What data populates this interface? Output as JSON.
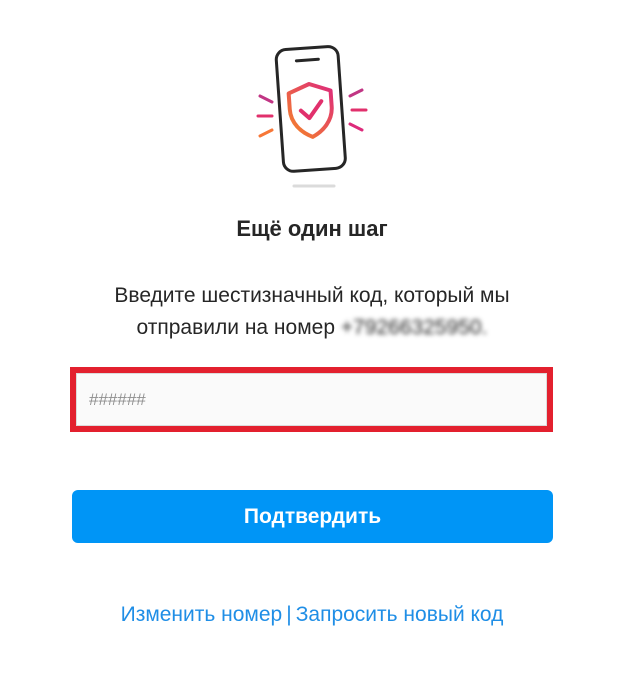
{
  "illustration": {
    "icon": "phone-shield-check-icon",
    "colors": {
      "outline": "#262626",
      "shield_gradient_start": "#f58529",
      "shield_gradient_end": "#dd2a7b",
      "rays_pink": "#c13584",
      "rays_orange": "#f77737"
    }
  },
  "title": "Ещё один шаг",
  "description": {
    "text": "Введите шестизначный код, который мы отправили на номер",
    "phone_masked": "+79266325950."
  },
  "code_input": {
    "placeholder": "######",
    "value": ""
  },
  "confirm_button": {
    "label": "Подтвердить",
    "color": "#0095f6"
  },
  "links": {
    "change_number": "Изменить номер",
    "separator": "|",
    "request_new_code": "Запросить новый код"
  },
  "highlight": {
    "color": "#e3202e"
  }
}
